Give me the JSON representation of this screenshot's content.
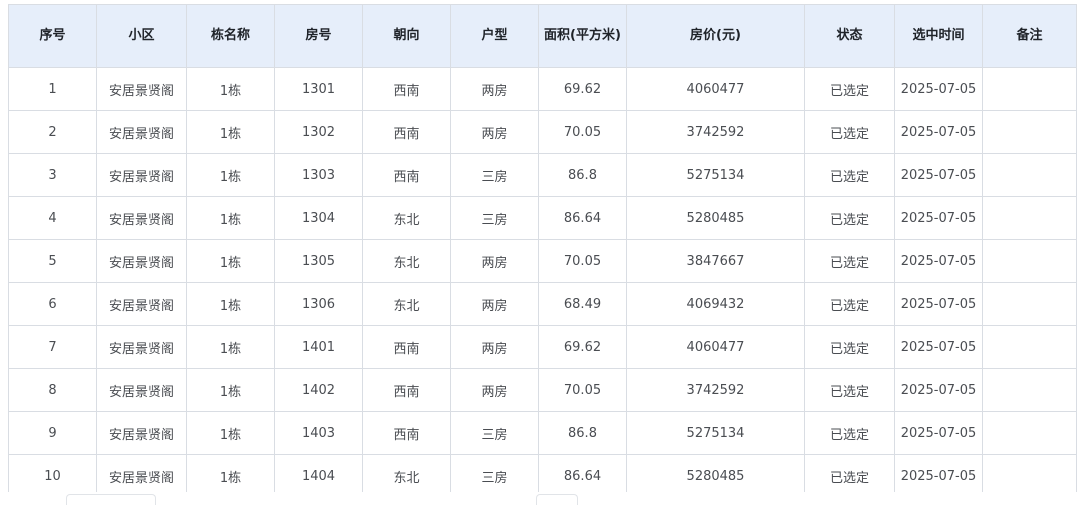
{
  "table": {
    "headers": [
      "序号",
      "小区",
      "栋名称",
      "房号",
      "朝向",
      "户型",
      "面积(平方米)",
      "房价(元)",
      "状态",
      "选中时间",
      "备注"
    ],
    "rows": [
      [
        "1",
        "安居景贤阁",
        "1栋",
        "1301",
        "西南",
        "两房",
        "69.62",
        "4060477",
        "已选定",
        "2025-07-05",
        ""
      ],
      [
        "2",
        "安居景贤阁",
        "1栋",
        "1302",
        "西南",
        "两房",
        "70.05",
        "3742592",
        "已选定",
        "2025-07-05",
        ""
      ],
      [
        "3",
        "安居景贤阁",
        "1栋",
        "1303",
        "西南",
        "三房",
        "86.8",
        "5275134",
        "已选定",
        "2025-07-05",
        ""
      ],
      [
        "4",
        "安居景贤阁",
        "1栋",
        "1304",
        "东北",
        "三房",
        "86.64",
        "5280485",
        "已选定",
        "2025-07-05",
        ""
      ],
      [
        "5",
        "安居景贤阁",
        "1栋",
        "1305",
        "东北",
        "两房",
        "70.05",
        "3847667",
        "已选定",
        "2025-07-05",
        ""
      ],
      [
        "6",
        "安居景贤阁",
        "1栋",
        "1306",
        "东北",
        "两房",
        "68.49",
        "4069432",
        "已选定",
        "2025-07-05",
        ""
      ],
      [
        "7",
        "安居景贤阁",
        "1栋",
        "1401",
        "西南",
        "两房",
        "69.62",
        "4060477",
        "已选定",
        "2025-07-05",
        ""
      ],
      [
        "8",
        "安居景贤阁",
        "1栋",
        "1402",
        "西南",
        "两房",
        "70.05",
        "3742592",
        "已选定",
        "2025-07-05",
        ""
      ],
      [
        "9",
        "安居景贤阁",
        "1栋",
        "1403",
        "西南",
        "三房",
        "86.8",
        "5275134",
        "已选定",
        "2025-07-05",
        ""
      ],
      [
        "10",
        "安居景贤阁",
        "1栋",
        "1404",
        "东北",
        "三房",
        "86.64",
        "5280485",
        "已选定",
        "2025-07-05",
        ""
      ]
    ]
  }
}
